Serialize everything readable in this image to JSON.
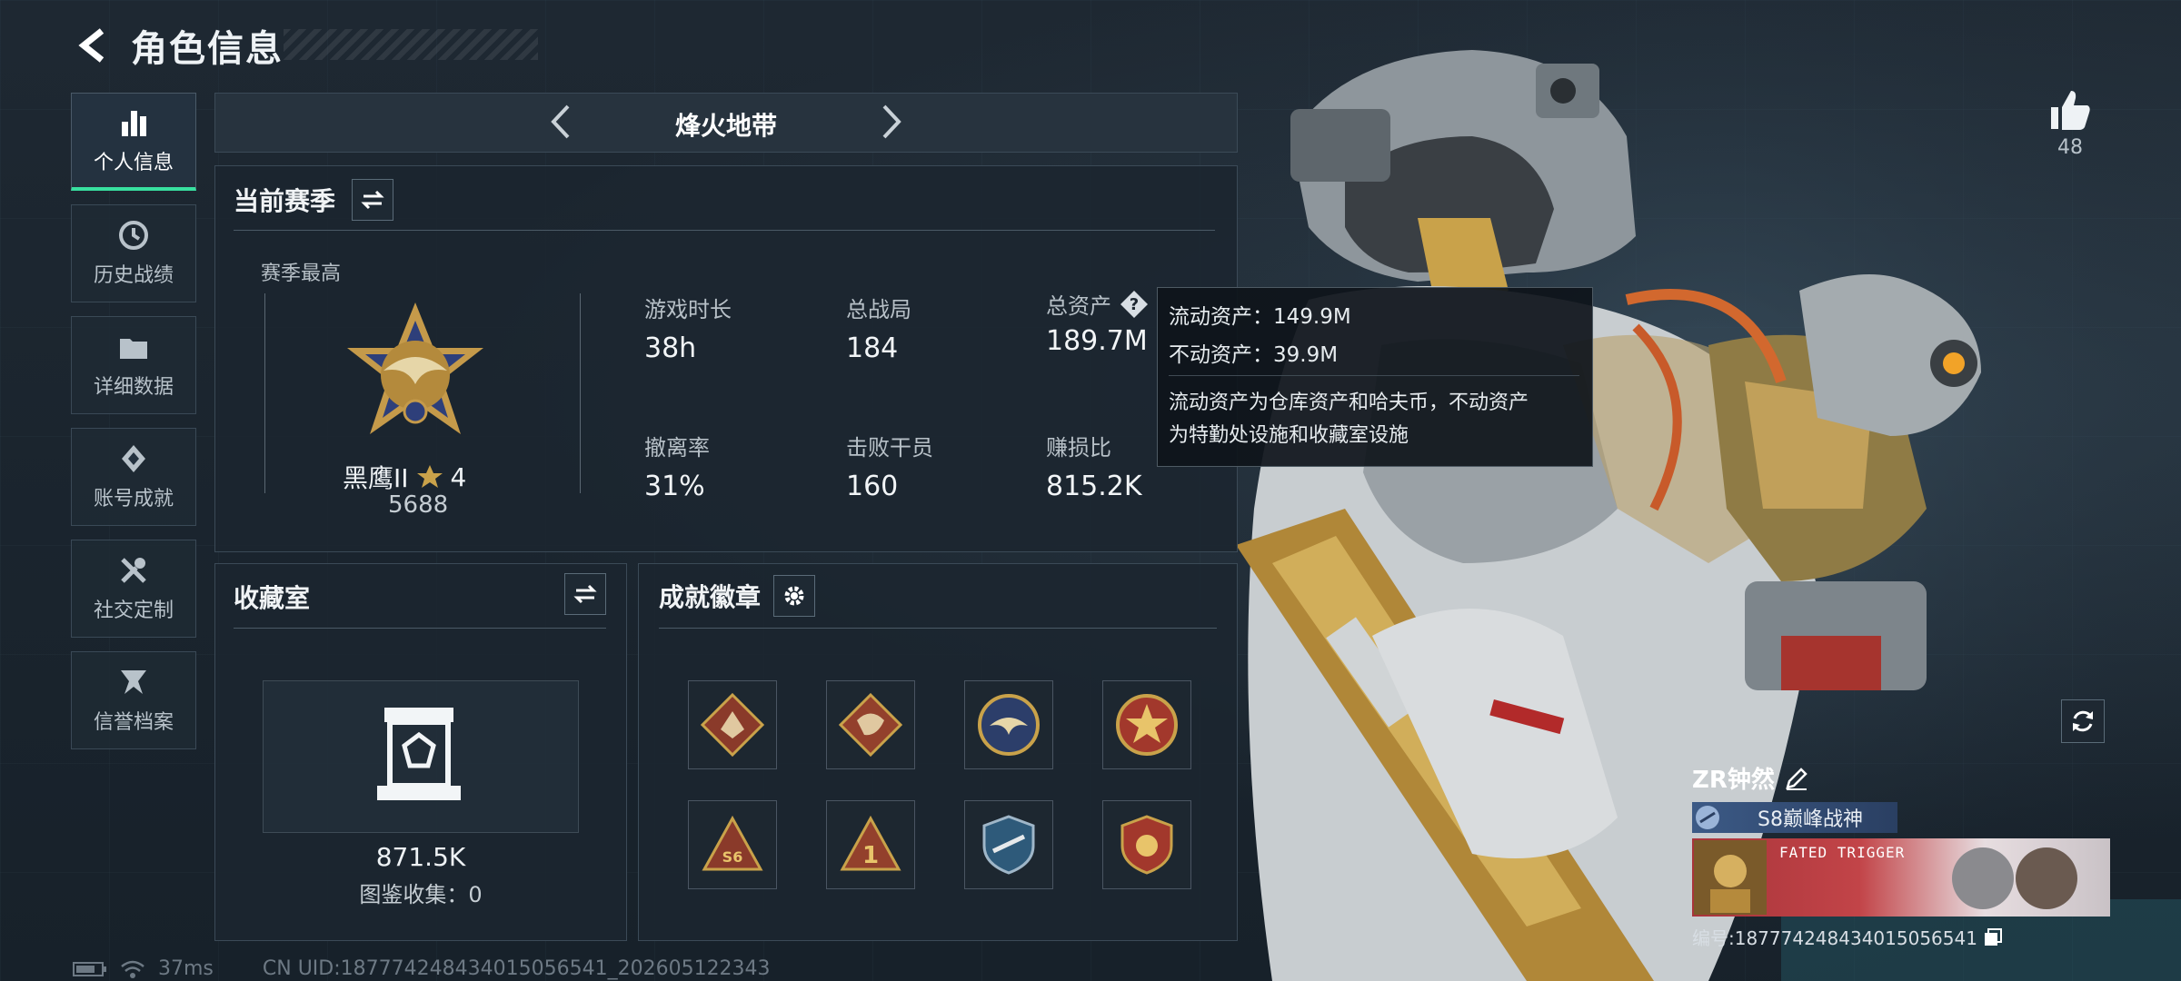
{
  "header": {
    "title": "角色信息"
  },
  "sidebar": {
    "items": [
      {
        "label": "个人信息",
        "icon": "bar-chart-icon",
        "active": true
      },
      {
        "label": "历史战绩",
        "icon": "history-icon"
      },
      {
        "label": "详细数据",
        "icon": "folder-icon"
      },
      {
        "label": "账号成就",
        "icon": "achievement-icon"
      },
      {
        "label": "社交定制",
        "icon": "tools-icon"
      },
      {
        "label": "信誉档案",
        "icon": "credit-icon"
      }
    ]
  },
  "mode": {
    "name": "烽火地带"
  },
  "season": {
    "title": "当前赛季",
    "best_label": "赛季最高",
    "rank_name": "黑鹰II",
    "rank_stars": "4",
    "rank_score": "5688",
    "stats": [
      {
        "label": "游戏时长",
        "value": "38h"
      },
      {
        "label": "总战局",
        "value": "184"
      },
      {
        "label": "总资产",
        "value": "189.7M"
      },
      {
        "label": "撤离率",
        "value": "31%"
      },
      {
        "label": "击败干员",
        "value": "160"
      },
      {
        "label": "赚损比",
        "value": "815.2K"
      }
    ]
  },
  "tooltip": {
    "liquid": "流动资产：149.9M",
    "fixed": "不动资产：39.9M",
    "desc_line1": "流动资产为仓库资产和哈夫币，不动资产",
    "desc_line2": "为特勤处设施和收藏室设施"
  },
  "collection": {
    "title": "收藏室",
    "value": "871.5K",
    "catalog": "图鉴收集：0"
  },
  "achievements": {
    "title": "成就徽章",
    "badges": [
      "wolf-badge",
      "dragon-badge",
      "eagle-badge",
      "star-medal-badge",
      "s6-triangle-badge",
      "number-one-badge",
      "shield-wings-badge",
      "crest-badge"
    ]
  },
  "like": {
    "count": "48"
  },
  "player": {
    "name": "ZR钟然",
    "title_badge": "S8巅峰战神",
    "banner_text": "FATED TRIGGER",
    "id_text": "编号:187774248434015056541"
  },
  "footer": {
    "ping": "37ms",
    "uid": "CN UID:187774248434015056541_202605122343"
  },
  "colors": {
    "accent": "#38e0a0",
    "gold": "#c9a24a",
    "panel": "#1c2630"
  }
}
